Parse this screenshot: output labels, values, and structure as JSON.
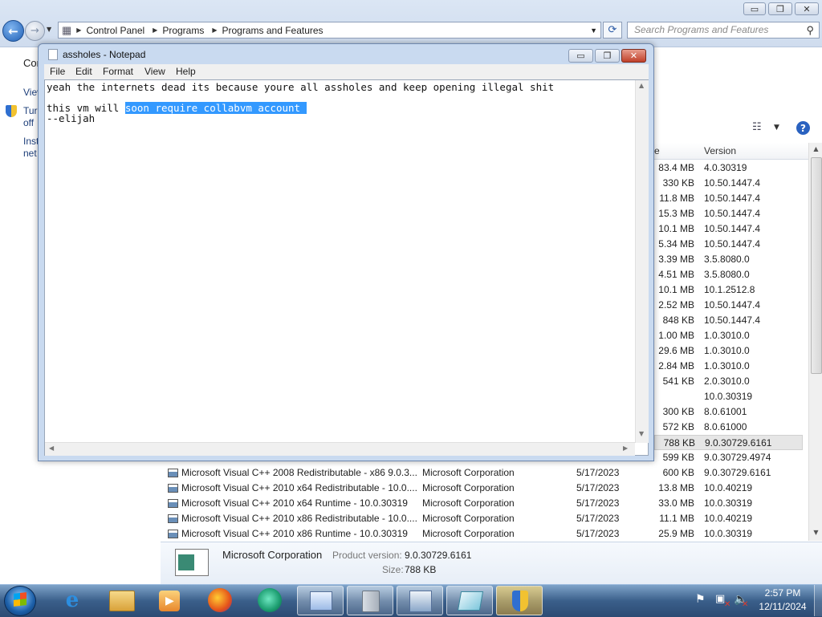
{
  "explorer": {
    "caption_buttons": {
      "minimize": "▭",
      "maximize": "❐",
      "close": "✕"
    },
    "breadcrumbs": [
      "Control Panel",
      "Programs",
      "Programs and Features"
    ],
    "search_placeholder": "Search Programs and Features",
    "left_pane": [
      "Cor",
      "Viev",
      "Turr",
      "off",
      "Inst",
      "net"
    ],
    "column_headers": {
      "size_partial": "e",
      "version": "Version"
    },
    "right_rows": [
      {
        "size": "83.4 MB",
        "version": "4.0.30319"
      },
      {
        "size": "330 KB",
        "version": "10.50.1447.4"
      },
      {
        "size": "11.8 MB",
        "version": "10.50.1447.4"
      },
      {
        "size": "15.3 MB",
        "version": "10.50.1447.4"
      },
      {
        "size": "10.1 MB",
        "version": "10.50.1447.4"
      },
      {
        "size": "5.34 MB",
        "version": "10.50.1447.4"
      },
      {
        "size": "3.39 MB",
        "version": "3.5.8080.0"
      },
      {
        "size": "4.51 MB",
        "version": "3.5.8080.0"
      },
      {
        "size": "10.1 MB",
        "version": "10.1.2512.8"
      },
      {
        "size": "2.52 MB",
        "version": "10.50.1447.4"
      },
      {
        "size": "848 KB",
        "version": "10.50.1447.4"
      },
      {
        "size": "1.00 MB",
        "version": "1.0.3010.0"
      },
      {
        "size": "29.6 MB",
        "version": "1.0.3010.0"
      },
      {
        "size": "2.84 MB",
        "version": "1.0.3010.0"
      },
      {
        "size": "541 KB",
        "version": "2.0.3010.0"
      },
      {
        "size": "",
        "version": "10.0.30319"
      },
      {
        "size": "300 KB",
        "version": "8.0.61001"
      },
      {
        "size": "572 KB",
        "version": "8.0.61000"
      },
      {
        "size": "788 KB",
        "version": "9.0.30729.6161"
      },
      {
        "size": "599 KB",
        "version": "9.0.30729.4974"
      }
    ],
    "full_rows": [
      {
        "name": "Microsoft Visual C++ 2008 Redistributable - x86 9.0.3...",
        "publisher": "Microsoft Corporation",
        "installed": "5/17/2023",
        "size": "600 KB",
        "version": "9.0.30729.6161"
      },
      {
        "name": "Microsoft Visual C++ 2010  x64 Redistributable - 10.0....",
        "publisher": "Microsoft Corporation",
        "installed": "5/17/2023",
        "size": "13.8 MB",
        "version": "10.0.40219"
      },
      {
        "name": "Microsoft Visual C++ 2010  x64 Runtime - 10.0.30319",
        "publisher": "Microsoft Corporation",
        "installed": "5/17/2023",
        "size": "33.0 MB",
        "version": "10.0.30319"
      },
      {
        "name": "Microsoft Visual C++ 2010  x86 Redistributable - 10.0....",
        "publisher": "Microsoft Corporation",
        "installed": "5/17/2023",
        "size": "11.1 MB",
        "version": "10.0.40219"
      },
      {
        "name": "Microsoft Visual C++ 2010  x86 Runtime - 10.0.30319",
        "publisher": "Microsoft Corporation",
        "installed": "5/17/2023",
        "size": "25.9 MB",
        "version": "10.0.30319"
      }
    ],
    "details": {
      "publisher": "Microsoft Corporation",
      "product_version_label": "Product version:",
      "product_version": "9.0.30729.6161",
      "size_label": "Size:",
      "size": "788 KB"
    }
  },
  "notepad": {
    "title": "assholes - Notepad",
    "menu": [
      "File",
      "Edit",
      "Format",
      "View",
      "Help"
    ],
    "line1": "yeah the internets dead its because youre all assholes and keep opening illegal shit",
    "line2_prefix": "this vm will ",
    "line2_selected": "soon require collabvm account ",
    "line3": "--elijah"
  },
  "taskbar": {
    "clock_time": "2:57 PM",
    "clock_date": "12/11/2024"
  }
}
